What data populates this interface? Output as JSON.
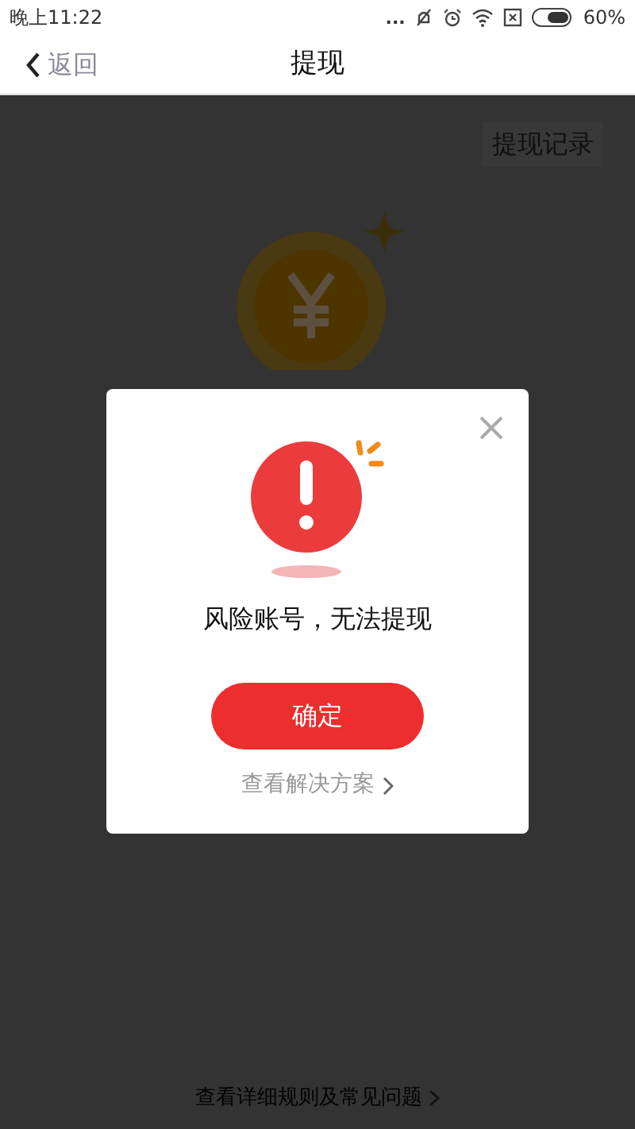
{
  "status_bar": {
    "time": "晚上11:22",
    "dots": "...",
    "battery": "60%"
  },
  "header": {
    "back": "返回",
    "title": "提现"
  },
  "page": {
    "records_button": "提现记录",
    "bottom_link": "查看详细规则及常见问题"
  },
  "dialog": {
    "message": "风险账号，无法提现",
    "confirm": "确定",
    "solution_link": "查看解决方案"
  }
}
